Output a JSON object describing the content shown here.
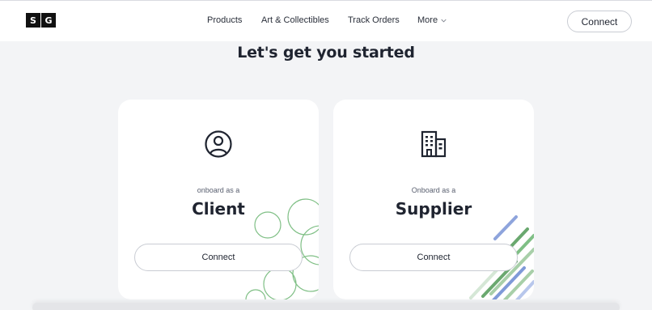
{
  "header": {
    "logo_letters": [
      "S",
      "G"
    ],
    "nav": [
      {
        "label": "Products"
      },
      {
        "label": "Art & Collectibles"
      },
      {
        "label": "Track Orders"
      },
      {
        "label": "More"
      }
    ],
    "connect_label": "Connect"
  },
  "main": {
    "title": "Let's get you started",
    "cards": [
      {
        "subtitle": "onboard as a",
        "title": "Client",
        "button_label": "Connect",
        "icon": "user-circle-icon"
      },
      {
        "subtitle": "Onboard as a",
        "title": "Supplier",
        "button_label": "Connect",
        "icon": "building-icon"
      }
    ]
  },
  "colors": {
    "background": "#f3f4f6",
    "card": "#ffffff",
    "text": "#1f2430",
    "deco_green": "#6aa86f",
    "deco_blue": "#7f9ad8"
  }
}
